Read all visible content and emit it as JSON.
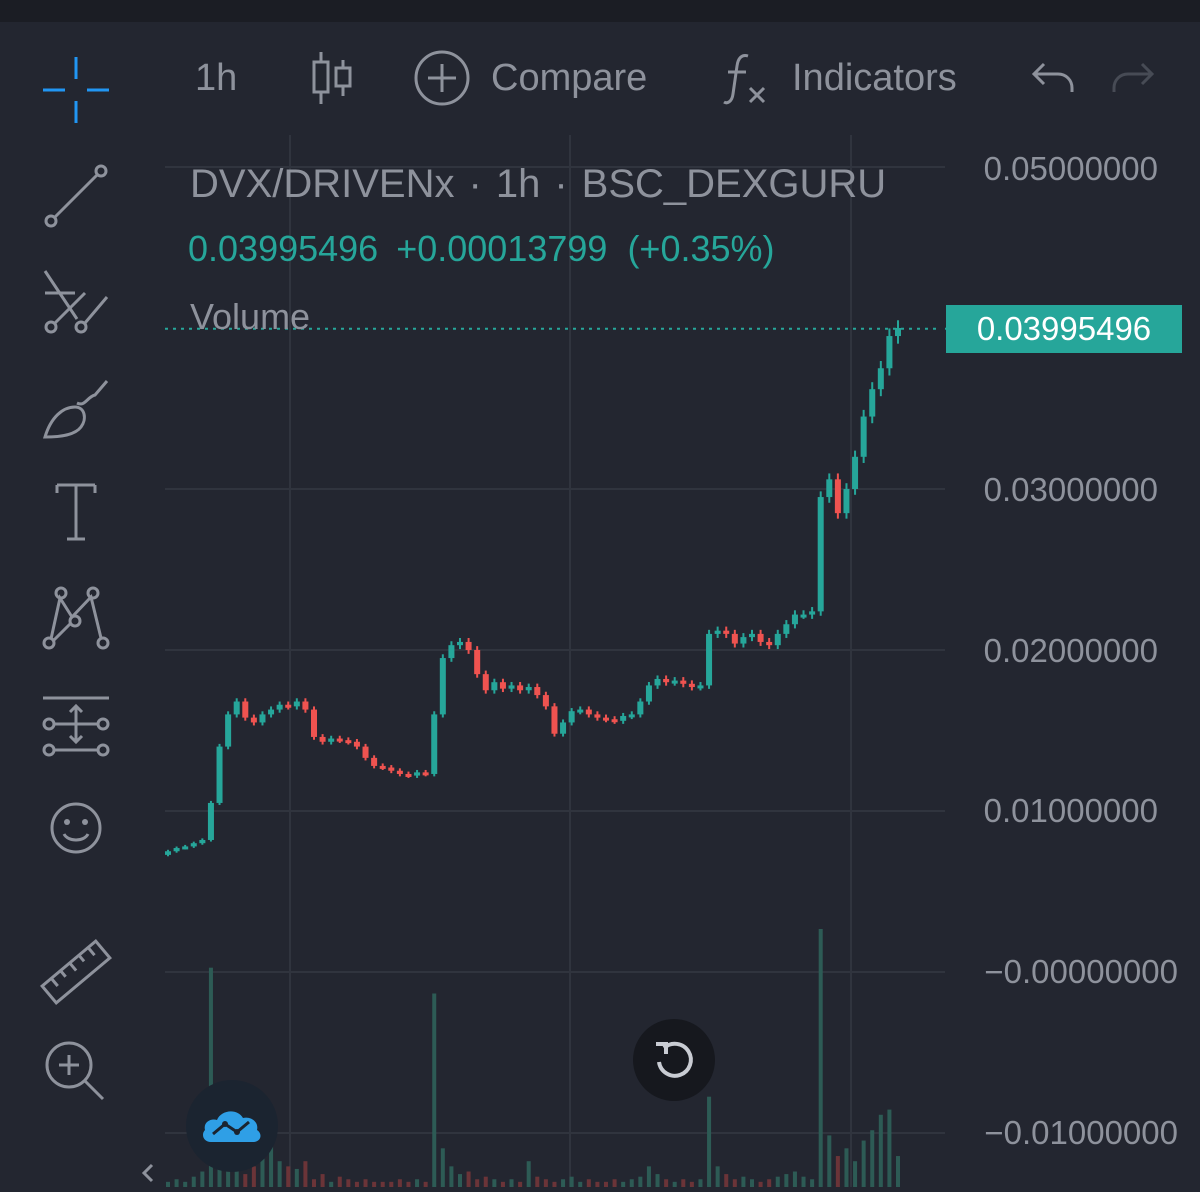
{
  "toolbar": {
    "interval": "1h",
    "compare_label": "Compare",
    "indicators_label": "Indicators"
  },
  "legend": {
    "symbol": "DVX/DRIVENx",
    "interval": "1h",
    "exchange": "BSC_DEXGURU",
    "separator": "·",
    "last": "0.03995496",
    "change": "+0.00013799",
    "change_pct": "(+0.35%)",
    "volume_label": "Volume"
  },
  "price_axis": {
    "ticks": [
      "0.05000000",
      "0.03000000",
      "0.02000000",
      "0.01000000",
      "−0.00000000",
      "−0.01000000"
    ],
    "last_price_tag": "0.03995496"
  },
  "icons": {
    "sidebar": [
      "crosshair-icon",
      "trend-line-icon",
      "pitchfork-icon",
      "brush-icon",
      "text-icon",
      "pattern-icon",
      "projection-icon",
      "emoji-icon",
      "ruler-icon",
      "zoom-in-icon"
    ],
    "toolbar": [
      "candles-icon",
      "plus-circle-icon",
      "fx-icon",
      "undo-icon",
      "redo-icon"
    ],
    "other": [
      "reset-chart-icon",
      "dexguru-logo-icon",
      "chevron-left-icon"
    ]
  },
  "colors": {
    "background": "#232630",
    "up": "#26a69a",
    "down": "#ef5350",
    "active_tool": "#2196f3",
    "text": "#8e929c",
    "grid": "#30343e"
  },
  "chart_data": {
    "type": "candlestick",
    "symbol": "DVX/DRIVENx",
    "interval": "1h",
    "y_ticks": [
      0.05,
      0.03,
      0.02,
      0.01,
      0,
      -0.01
    ],
    "last_price": 0.03995496,
    "close_path": [
      0.0075,
      0.0077,
      0.0078,
      0.008,
      0.0082,
      0.0105,
      0.014,
      0.016,
      0.0168,
      0.0158,
      0.0155,
      0.016,
      0.0163,
      0.0166,
      0.0165,
      0.0168,
      0.0163,
      0.0146,
      0.0143,
      0.0145,
      0.0144,
      0.0143,
      0.014,
      0.0133,
      0.0128,
      0.0127,
      0.0125,
      0.0123,
      0.0122,
      0.0124,
      0.0123,
      0.016,
      0.0195,
      0.0203,
      0.0205,
      0.02,
      0.0185,
      0.0175,
      0.018,
      0.0176,
      0.0178,
      0.0175,
      0.0177,
      0.0172,
      0.0165,
      0.0148,
      0.0155,
      0.0162,
      0.0163,
      0.016,
      0.0158,
      0.0157,
      0.0156,
      0.0159,
      0.016,
      0.0168,
      0.0178,
      0.0182,
      0.018,
      0.0181,
      0.0179,
      0.0177,
      0.0178,
      0.021,
      0.0212,
      0.021,
      0.0204,
      0.0208,
      0.021,
      0.0205,
      0.0203,
      0.021,
      0.0216,
      0.0222,
      0.0222,
      0.0224,
      0.0295,
      0.0306,
      0.0285,
      0.03,
      0.032,
      0.0345,
      0.0362,
      0.0375,
      0.0395,
      0.04
    ],
    "volume_relative": [
      0.02,
      0.03,
      0.02,
      0.04,
      0.06,
      0.85,
      0.25,
      0.15,
      0.1,
      0.05,
      0.08,
      0.12,
      0.18,
      0.1,
      0.08,
      0.07,
      0.1,
      0.03,
      0.05,
      0.02,
      0.04,
      0.03,
      0.02,
      0.03,
      0.02,
      0.02,
      0.02,
      0.03,
      0.02,
      0.03,
      0.02,
      0.75,
      0.15,
      0.08,
      0.05,
      0.06,
      0.03,
      0.04,
      0.03,
      0.02,
      0.03,
      0.02,
      0.1,
      0.04,
      0.03,
      0.02,
      0.03,
      0.04,
      0.02,
      0.03,
      0.02,
      0.02,
      0.03,
      0.02,
      0.03,
      0.04,
      0.08,
      0.05,
      0.03,
      0.02,
      0.03,
      0.02,
      0.03,
      0.35,
      0.08,
      0.05,
      0.03,
      0.04,
      0.03,
      0.02,
      0.03,
      0.04,
      0.05,
      0.06,
      0.04,
      0.03,
      1.0,
      0.2,
      0.12,
      0.15,
      0.1,
      0.18,
      0.22,
      0.28,
      0.3,
      0.12
    ]
  }
}
